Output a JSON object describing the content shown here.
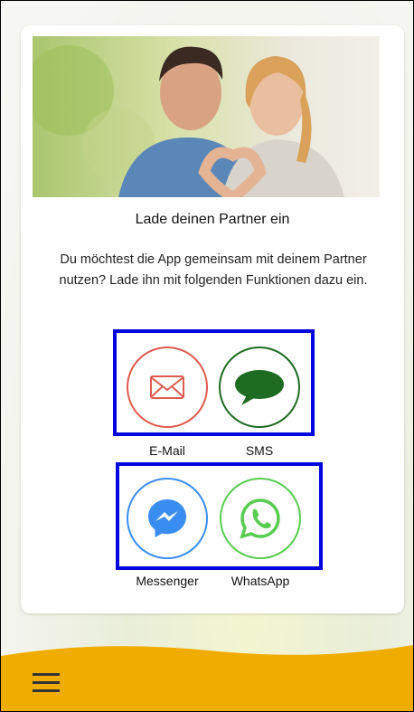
{
  "invite": {
    "title": "Lade deinen Partner ein",
    "description": "Du möchtest die App gemeinsam mit deinem Partner nutzen? Lade ihn mit folgenden Funktionen dazu ein."
  },
  "share_options": [
    {
      "label": "E-Mail",
      "icon": "mail-icon",
      "color": "#e05a50"
    },
    {
      "label": "SMS",
      "icon": "speech-bubble-icon",
      "color": "#1e6b22"
    },
    {
      "label": "Messenger",
      "icon": "messenger-icon",
      "color": "#3a8df0"
    },
    {
      "label": "WhatsApp",
      "icon": "whatsapp-icon",
      "color": "#57cc4f"
    }
  ],
  "colors": {
    "highlight": "#0006e0",
    "bottom_bar": "#f0ac00"
  },
  "nav": {
    "menu_icon": "hamburger-menu-icon"
  }
}
